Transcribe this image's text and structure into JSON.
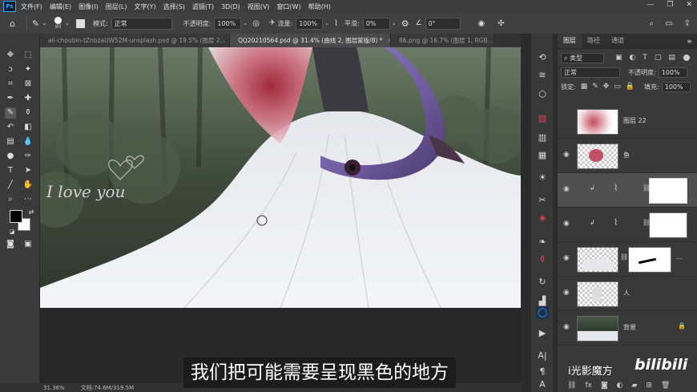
{
  "app": {
    "logo": "Ps"
  },
  "menu": [
    "文件(F)",
    "编辑(E)",
    "图像(I)",
    "图层(L)",
    "文字(Y)",
    "选择(S)",
    "滤镜(T)",
    "3D(D)",
    "视图(V)",
    "窗口(W)",
    "帮助(H)"
  ],
  "options": {
    "brush_size": "90",
    "mode_label": "模式:",
    "mode_value": "正常",
    "opacity_label": "不透明度:",
    "opacity_value": "100%",
    "flow_label": "流量:",
    "flow_value": "100%",
    "smooth_label": "平滑:",
    "smooth_value": "0%",
    "angle_value": "0°"
  },
  "tabs": [
    {
      "label": "ali-choubin-tZnbzaUW52M-unsplash.psd @ 19.5% (图层 2...",
      "active": false
    },
    {
      "label": "QQ20210564.psd @ 31.4% (曲线 2, 图层蒙版/8) *",
      "active": true
    },
    {
      "label": "86.png @ 16.7% (图层 1, RGB...",
      "active": false
    }
  ],
  "status": {
    "zoom": "31.36%",
    "doc": "文档:74.6M/319.5M"
  },
  "panel": {
    "tabs": [
      "图层",
      "路径",
      "通道"
    ],
    "filter_kind": "类型",
    "blend_mode": "正常",
    "opacity_label": "不透明度:",
    "opacity_value": "100%",
    "lock_label": "锁定:",
    "fill_label": "填充:",
    "fill_value": "100%",
    "layers": [
      {
        "name": "图层 22",
        "visible": false
      },
      {
        "name": "鱼",
        "visible": true
      },
      {
        "name": "",
        "visible": true
      },
      {
        "name": "",
        "visible": true
      },
      {
        "name": "",
        "visible": true
      },
      {
        "name": "人",
        "visible": true
      },
      {
        "name": "背景",
        "visible": true
      }
    ]
  },
  "canvas_text": {
    "love": "I love you"
  },
  "subtitle": "我们把可能需要呈现黑色的地方",
  "watermark": "i光影魔方",
  "bilibili": "bilibili",
  "colors": {
    "foreground": "#000000",
    "background": "#ffffff",
    "accent": "#31a8ff"
  }
}
